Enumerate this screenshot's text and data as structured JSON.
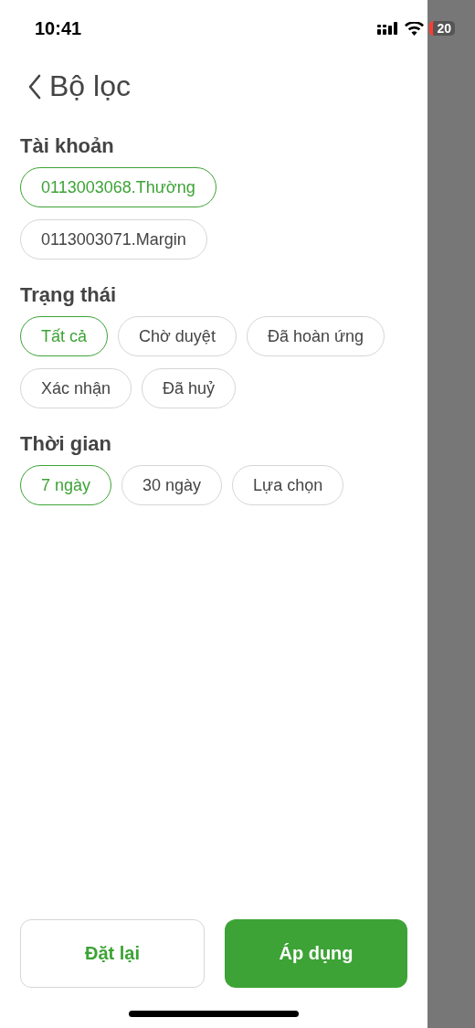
{
  "status_bar": {
    "time": "10:41",
    "battery": "20"
  },
  "header": {
    "title": "Bộ lọc"
  },
  "sections": [
    {
      "title": "Tài khoản",
      "kind": "stack",
      "options": [
        {
          "label": "0113003068.Thường",
          "selected": true
        },
        {
          "label": "0113003071.Margin",
          "selected": false
        }
      ]
    },
    {
      "title": "Trạng thái",
      "kind": "wrap",
      "options": [
        {
          "label": "Tất cả",
          "selected": true
        },
        {
          "label": "Chờ duyệt",
          "selected": false
        },
        {
          "label": "Đã hoàn ứng",
          "selected": false
        },
        {
          "label": "Xác nhận",
          "selected": false
        },
        {
          "label": "Đã huỷ",
          "selected": false
        }
      ]
    },
    {
      "title": "Thời gian",
      "kind": "wrap",
      "options": [
        {
          "label": "7 ngày",
          "selected": true
        },
        {
          "label": "30 ngày",
          "selected": false
        },
        {
          "label": "Lựa chọn",
          "selected": false
        }
      ]
    }
  ],
  "buttons": [
    {
      "label": "Đặt lại",
      "kind": "secondary"
    },
    {
      "label": "Áp dụng",
      "kind": "primary"
    }
  ]
}
